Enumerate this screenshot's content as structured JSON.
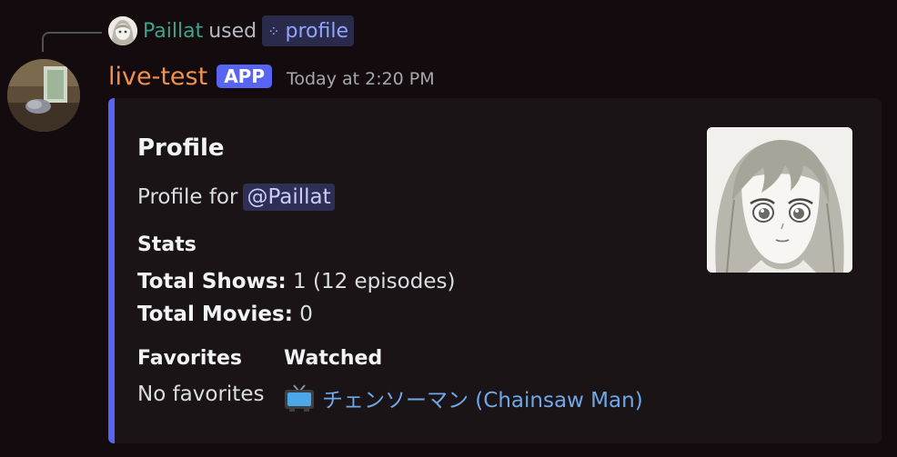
{
  "reply": {
    "user": "Paillat",
    "verb": "used",
    "command": "profile"
  },
  "author": {
    "name": "live-test",
    "badge": "APP",
    "timestamp": "Today at 2:20 PM"
  },
  "embed": {
    "accent_color": "#5865f2",
    "title": "Profile",
    "description_prefix": "Profile for",
    "mention": "@Paillat",
    "stats_title": "Stats",
    "total_shows_label": "Total Shows:",
    "total_shows_value": "1 (12 episodes)",
    "total_movies_label": "Total Movies:",
    "total_movies_value": "0",
    "favorites": {
      "name": "Favorites",
      "value": "No favorites"
    },
    "watched": {
      "name": "Watched",
      "icon": "tv-icon",
      "value": "チェンソーマン (Chainsaw Man)"
    }
  }
}
